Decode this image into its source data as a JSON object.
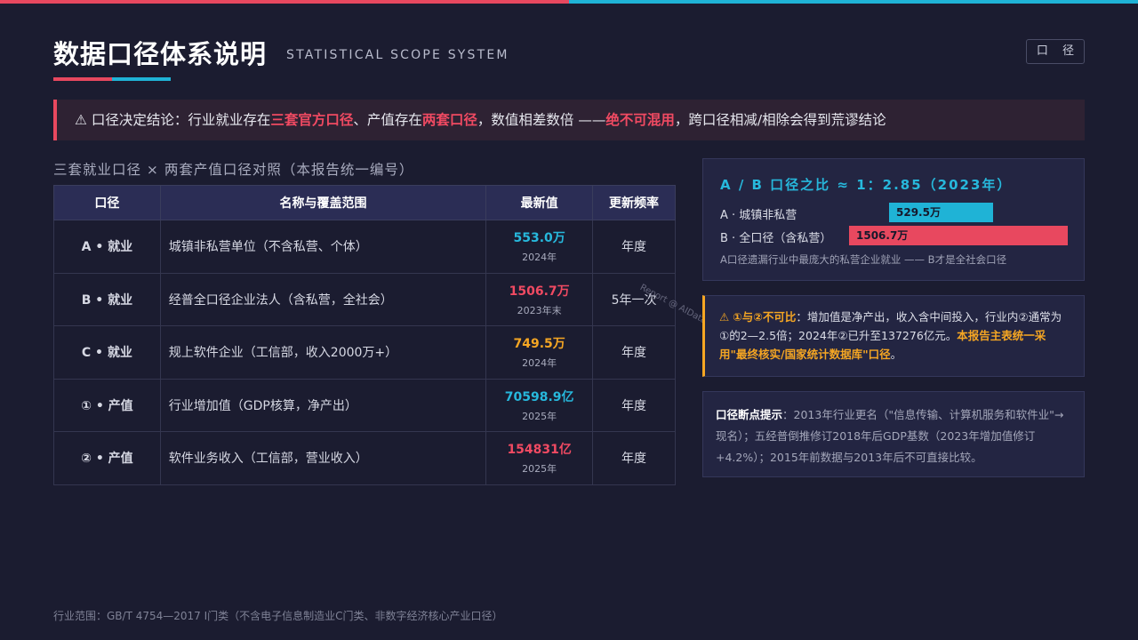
{
  "header": {
    "title": "数据口径体系说明",
    "subtitle": "STATISTICAL SCOPE SYSTEM",
    "tag_button": "口 径"
  },
  "alert": {
    "icon": "⚠",
    "p1": " 口径决定结论：行业就业存在",
    "h1": "三套官方口径",
    "p2": "、产值存在",
    "h2": "两套口径",
    "p3": "，数值相差数倍 ——",
    "h3": "绝不可混用",
    "p4": "，跨口径相减/相除会得到荒谬结论"
  },
  "section_title": "三套就业口径 × 两套产值口径对照（本报告统一编号）",
  "table": {
    "headers": [
      "口径",
      "名称与覆盖范围",
      "最新值",
      "更新频率"
    ],
    "rows": [
      {
        "id": "A • 就业",
        "desc": "城镇非私营单位（不含私营、个体）",
        "value": "553.0万",
        "year": "2024年",
        "freq": "年度",
        "color": "#27b8dc"
      },
      {
        "id": "B • 就业",
        "desc": "经普全口径企业法人（含私营，全社会）",
        "value": "1506.7万",
        "year": "2023年末",
        "freq": "5年一次",
        "color": "#f04a62"
      },
      {
        "id": "C • 就业",
        "desc": "规上软件企业（工信部，收入2000万+）",
        "value": "749.5万",
        "year": "2024年",
        "freq": "年度",
        "color": "#f5a623"
      },
      {
        "id": "① • 产值",
        "desc": "行业增加值（GDP核算，净产出）",
        "value": "70598.9亿",
        "year": "2025年",
        "freq": "年度",
        "color": "#27b8dc"
      },
      {
        "id": "② • 产值",
        "desc": "软件业务收入（工信部，营业收入）",
        "value": "154831亿",
        "year": "2025年",
        "freq": "年度",
        "color": "#f04a62"
      }
    ]
  },
  "ratio": {
    "title": "A / B 口径之比 ≈ 1：2.85（2023年）",
    "label_a": "A · 城镇非私营",
    "label_b": "B · 全口径（含私营）",
    "value_a": "529.5万",
    "value_b": "1506.7万",
    "note": "A口径遗漏行业中最庞大的私营企业就业 —— B才是全社会口径"
  },
  "warning": {
    "icon": "⚠",
    "lead": "①与②不可比",
    "body": "：增加值是净产出，收入含中间投入，行业内②通常为①的2—2.5倍；2024年②已升至137276亿元。",
    "emph": "本报告主表统一采用\"最终核实/国家统计数据库\"口径",
    "end": "。"
  },
  "breakpoint": {
    "lead": "口径断点提示",
    "body": "：2013年行业更名（\"信息传输、计算机服务和软件业\"→现名）；五经普倒推修订2018年后GDP基数（2023年增加值修订+4.2%）；2015年前数据与2013年后不可直接比较。"
  },
  "watermark": "Report @ AIDataSlides",
  "footer": "行业范围：GB/T 4754—2017 I门类（不含电子信息制造业C门类、非数字经济核心产业口径）",
  "colors": {
    "accent_red": "#e8485f",
    "accent_cyan": "#1fb3d6",
    "accent_orange": "#f5a623",
    "background": "#1b1c30"
  }
}
